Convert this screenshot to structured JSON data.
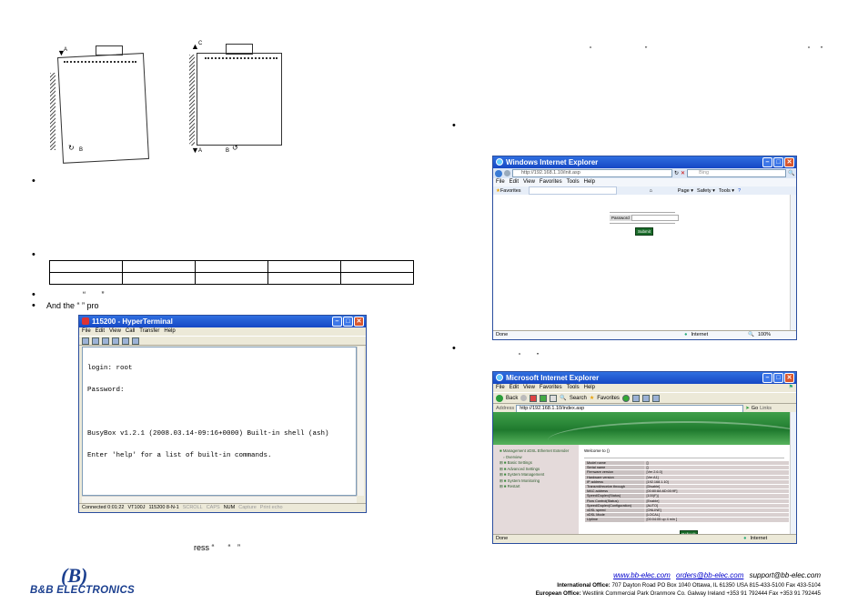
{
  "diagram": {
    "label_a": "A",
    "label_b": "B",
    "label_c": "C",
    "label_a2": "A",
    "label_b2": "B"
  },
  "left": {
    "quote_marks_1": "“       ”",
    "and_the": "And the “ ” pro",
    "press_line": "ress “      “   ”"
  },
  "right": {
    "quote_marks_top_a": "“",
    "quote_marks_top_b": "”",
    "quote_marks_top_c": "“      ”",
    "quote_marks_mid": "“         ”"
  },
  "hyperterminal": {
    "title": "115200 - HyperTerminal",
    "menu": [
      "File",
      "Edit",
      "View",
      "Call",
      "Transfer",
      "Help"
    ],
    "lines": [
      "login: root",
      "Password:",
      "",
      "BusyBox v1.2.1 (2008.03.14-09:16+0000) Built-in shell (ash)",
      "Enter 'help' for a list of built-in commands.",
      "",
      "~ #"
    ],
    "status": [
      "Connected 0:01:22",
      "VT100J",
      "115200 8-N-1",
      "SCROLL",
      "CAPS",
      "NUM",
      "Capture",
      "Print echo"
    ]
  },
  "ie_login": {
    "title": "Windows Internet Explorer",
    "address": "http://192.168.1.10/init.asp",
    "search_placeholder": "Bing",
    "menu": [
      "File",
      "Edit",
      "View",
      "Favorites",
      "Tools",
      "Help"
    ],
    "favorites": "Favorites",
    "toolbar_items": [
      "Page ▾",
      "Safety ▾",
      "Tools ▾"
    ],
    "password_label": "Password",
    "submit": "Submit",
    "status_left": "Done",
    "status_zone": "Internet",
    "zoom": "100%"
  },
  "ie_main": {
    "title": "Microsoft Internet Explorer",
    "menu": [
      "File",
      "Edit",
      "View",
      "Favorites",
      "Tools",
      "Help"
    ],
    "toolbar": [
      "Back",
      "Search",
      "Favorites"
    ],
    "address_label": "Address",
    "address": "http://192.168.1.10/index.asp",
    "go": "Go",
    "links": "Links",
    "nav": [
      "Management xDSL Ethernet Extender",
      "Overview",
      "Basic Settings",
      "Advanced Settings",
      "System Management",
      "System Monitoring",
      "Restart"
    ],
    "welcome": "Welcome to ()",
    "rows": [
      [
        "Model name",
        "[]"
      ],
      [
        "Serial name",
        "[]"
      ],
      [
        "Firmware version",
        "[Ver 2.6.0]"
      ],
      [
        "Hardware version",
        "[Ver A1]"
      ],
      [
        "IP address",
        "[192.168.1.10]"
      ],
      [
        "Transmit/receive through",
        "[Disable]"
      ],
      [
        "MAC address",
        "[00:80:8A:6D:00:9F]"
      ],
      [
        "Speed/Duplex(Status)",
        "[100(F)]"
      ],
      [
        "Flow Control(Status)",
        "[Enable]"
      ],
      [
        "Speed/Duplex(Configuration)",
        "[AUTO]"
      ],
      [
        "xDSL speed",
        "[ONLINE]"
      ],
      [
        "xDSL Mode",
        "[LOCAL]"
      ],
      [
        "Uptime",
        "[00:04:05 up 4 min ]"
      ]
    ],
    "refresh": "Refresh",
    "status_left": "Done",
    "status_zone": "Internet"
  },
  "footer": {
    "logo_text": "B&B ELECTRONICS",
    "web": "www.bb-elec.com",
    "orders": "orders@bb-elec.com",
    "support": "support@bb-elec.com",
    "intl_label": "International Office:",
    "intl_text": "707 Dayton Road PO Box 1040 Ottawa, IL 61350 USA 815-433-5100 Fax 433-5104",
    "eu_label": "European Office:",
    "eu_text": "Westlink Commercial Park  Oranmore Co. Galway Ireland  +353 91 792444 Fax +353 91 792445"
  },
  "colors": {
    "xp_blue": "#1547c4",
    "link_blue": "#0000cc",
    "ie_green": "#1a6b2a"
  }
}
